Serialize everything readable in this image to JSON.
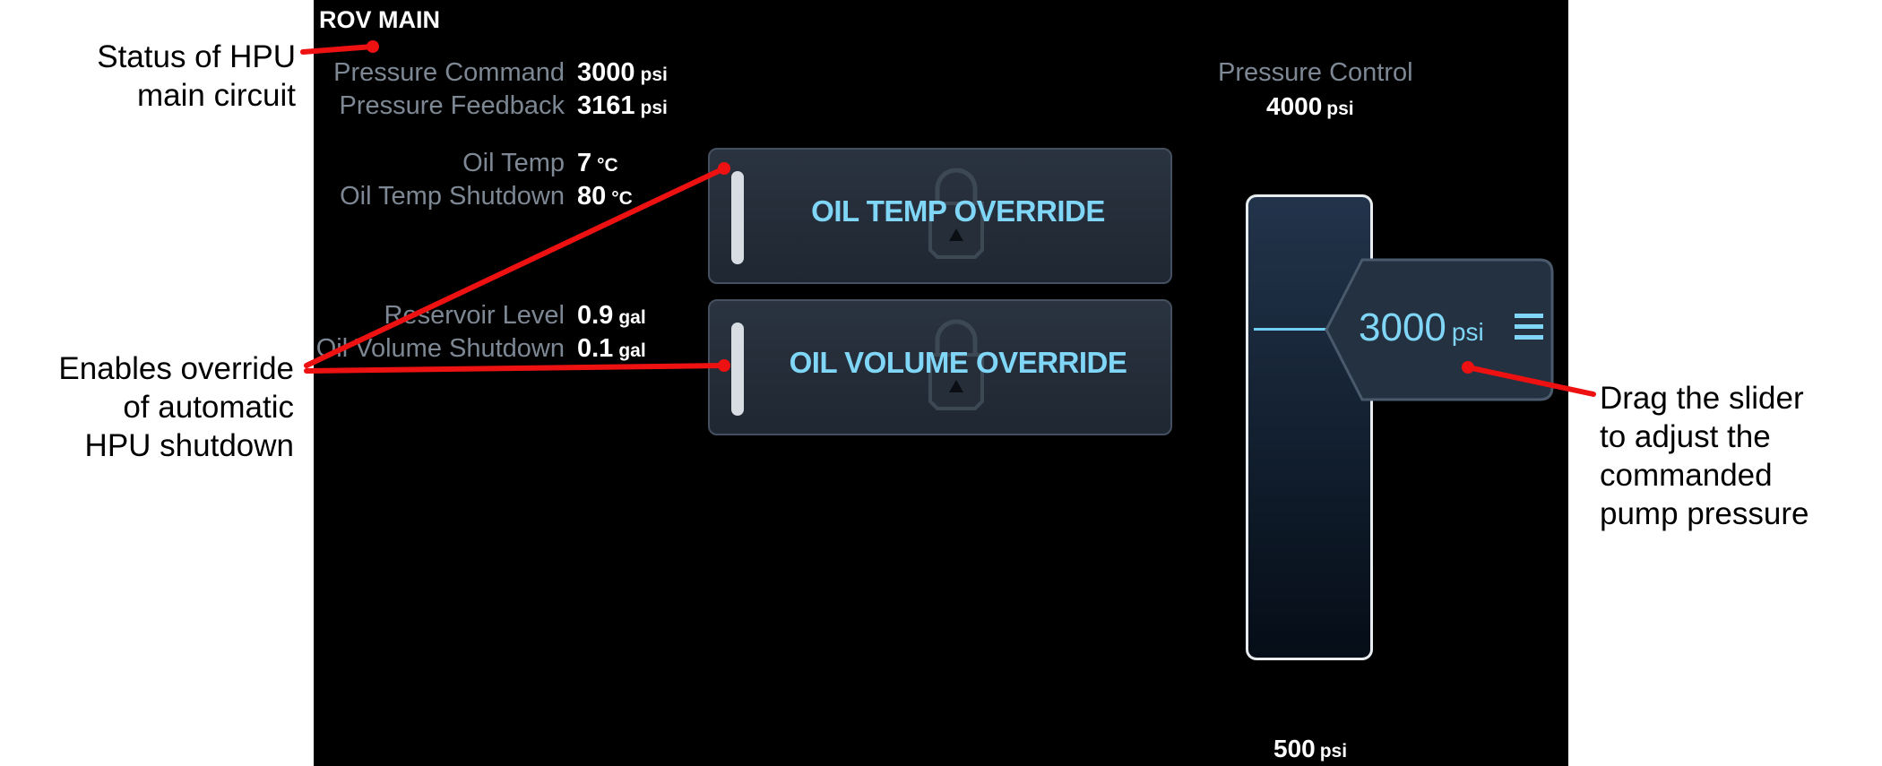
{
  "title": "ROV MAIN",
  "readouts": [
    {
      "label": "Pressure Command",
      "value": "3000",
      "unit": "psi"
    },
    {
      "label": "Pressure Feedback",
      "value": "3161",
      "unit": "psi"
    },
    {
      "label": "Oil Temp",
      "value": "7",
      "unit": "°C"
    },
    {
      "label": "Oil Temp Shutdown",
      "value": "80",
      "unit": "°C"
    },
    {
      "label": "Reservoir Level",
      "value": "0.9",
      "unit": "gal"
    },
    {
      "label": "Oil Volume Shutdown",
      "value": "0.1",
      "unit": "gal"
    }
  ],
  "overrides": {
    "oil_temp": {
      "label": "OIL TEMP OVERRIDE",
      "icon": "lock-icon"
    },
    "oil_volume": {
      "label": "OIL VOLUME OVERRIDE",
      "icon": "lock-icon"
    }
  },
  "pressure_control": {
    "label": "Pressure Control",
    "max_value": "4000",
    "min_value": "500",
    "unit": "psi",
    "current_value": "3000",
    "handle_icon": "grip-lines-icon"
  },
  "annotations": {
    "status": [
      "Status of HPU",
      "main  circuit"
    ],
    "override": [
      "Enables override",
      "of automatic",
      "HPU shutdown"
    ],
    "slider": [
      "Drag the slider",
      "to adjust the",
      "commanded",
      "pump pressure"
    ]
  },
  "colors": {
    "panel_bg": "#000000",
    "accent": "#7fd6f7",
    "label_gray": "#7d8894",
    "annotation_red": "#ee1111"
  }
}
